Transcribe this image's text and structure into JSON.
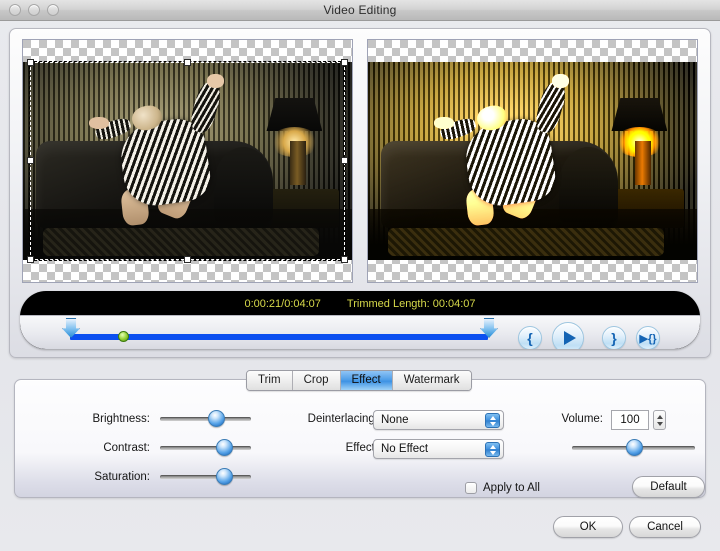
{
  "window": {
    "title": "Video Editing",
    "traffic_lights": [
      "close-button",
      "minimize-button",
      "zoom-button"
    ]
  },
  "preview": {
    "source_label": "source-preview",
    "output_label": "output-preview",
    "crop_handles": [
      "nw",
      "n",
      "ne",
      "w",
      "e",
      "sw",
      "s",
      "se"
    ]
  },
  "transport": {
    "position_duration": "0:00:21/0:04:07",
    "trimmed_length": "Trimmed Length: 00:04:07",
    "buttons": {
      "set_start": "{",
      "play": "▶",
      "set_end": "}",
      "preview_trim": "▶{}"
    }
  },
  "tabs": [
    {
      "label": "Trim",
      "active": false
    },
    {
      "label": "Crop",
      "active": false
    },
    {
      "label": "Effect",
      "active": true
    },
    {
      "label": "Watermark",
      "active": false
    }
  ],
  "effect_panel": {
    "brightness": {
      "label": "Brightness:",
      "value": 62
    },
    "contrast": {
      "label": "Contrast:",
      "value": 72
    },
    "saturation": {
      "label": "Saturation:",
      "value": 72
    },
    "deinterlacing": {
      "label": "Deinterlacing:",
      "value": "None"
    },
    "effect": {
      "label": "Effect:",
      "value": "No Effect"
    },
    "volume": {
      "label": "Volume:",
      "value": "100",
      "slider_value": 50
    },
    "apply_to_all": {
      "label": "Apply to All",
      "checked": false
    },
    "default_button": "Default"
  },
  "footer": {
    "ok_button": "OK",
    "cancel_button": "Cancel"
  },
  "colors": {
    "accent": "#3d92e4",
    "timecode": "#d7d94a",
    "timeline": "#0b4ff0",
    "playhead": "#9bd53c"
  }
}
